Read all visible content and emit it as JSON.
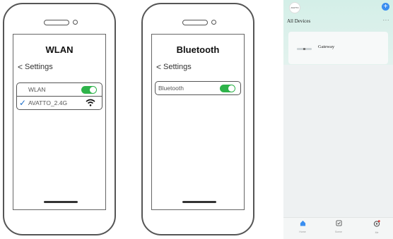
{
  "wlan_phone": {
    "title": "WLAN",
    "back_label": "Settings",
    "rows": [
      {
        "label": "WLAN"
      },
      {
        "label": "AVATTO_2.4G"
      }
    ]
  },
  "bluetooth_phone": {
    "title": "Bluetooth",
    "back_label": "Settings",
    "rows": [
      {
        "label": "Bluetooth"
      }
    ]
  },
  "app": {
    "logo_text": "AVATTO",
    "add_icon": "+",
    "section_title": "All Devices",
    "more_icon": "···",
    "devices": [
      {
        "name": "Gateway"
      }
    ],
    "tabs": [
      {
        "label": "Home",
        "icon": "home-icon"
      },
      {
        "label": "Scene",
        "icon": "scene-icon"
      },
      {
        "label": "Me",
        "icon": "me-icon"
      }
    ]
  },
  "colors": {
    "toggle_on": "#2eb34a",
    "check": "#1e6ec8",
    "accent": "#3a8ef0",
    "app_header": "#d4efe8"
  }
}
